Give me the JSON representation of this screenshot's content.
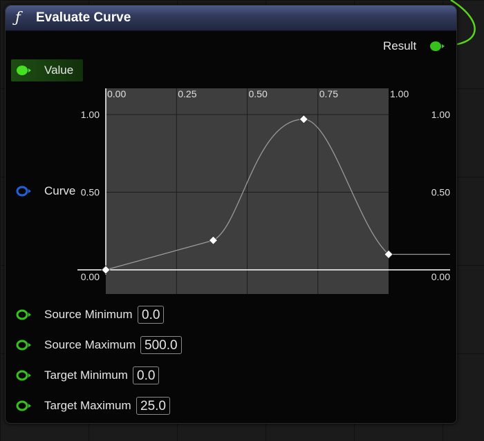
{
  "node": {
    "function_symbol": "ƒ",
    "title": "Evaluate Curve"
  },
  "outputs": {
    "result_label": "Result"
  },
  "value_pin": {
    "label": "Value"
  },
  "curve": {
    "label": "Curve",
    "x_ticks": [
      "0.00",
      "0.25",
      "0.50",
      "0.75",
      "1.00"
    ],
    "y_ticks_left": [
      "1.00",
      "0.50",
      "0.00"
    ],
    "y_ticks_right": [
      "1.00",
      "0.50",
      "0.00"
    ]
  },
  "chart_data": {
    "type": "line",
    "x_range": [
      0,
      1
    ],
    "y_range": [
      0,
      1
    ],
    "keys": [
      {
        "x": 0.0,
        "y": 0.0
      },
      {
        "x": 0.38,
        "y": 0.19
      },
      {
        "x": 0.7,
        "y": 0.97
      },
      {
        "x": 1.0,
        "y": 0.1
      }
    ]
  },
  "inputs": [
    {
      "label": "Source Minimum",
      "value": "0.0"
    },
    {
      "label": "Source Maximum",
      "value": "500.0"
    },
    {
      "label": "Target Minimum",
      "value": "0.0"
    },
    {
      "label": "Target Maximum",
      "value": "25.0"
    }
  ],
  "colors": {
    "exec_green": "#33cc11",
    "float_pin": "#35c31b",
    "curve_pin": "#1e62d8",
    "wire": "#5ad61c"
  }
}
